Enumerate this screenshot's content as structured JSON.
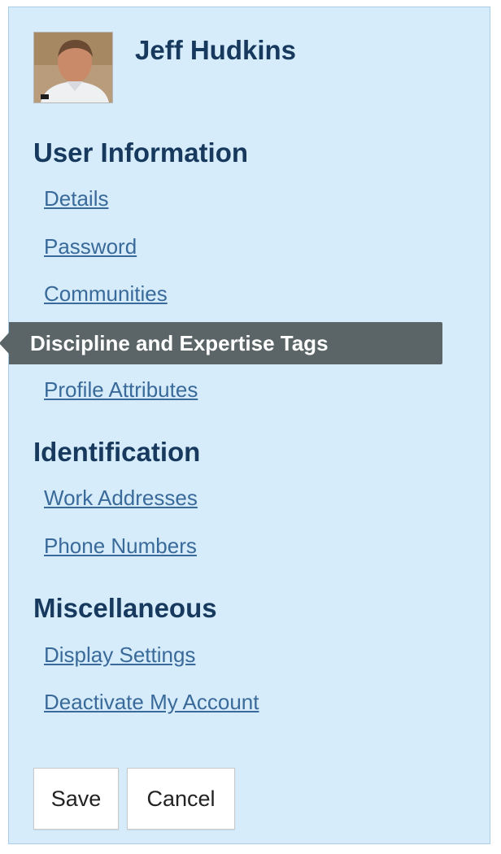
{
  "profile": {
    "name": "Jeff Hudkins",
    "avatar_icon": "user-photo"
  },
  "sections": {
    "user_information": {
      "title": "User Information",
      "links": {
        "details": "Details",
        "password": "Password",
        "communities": "Communities",
        "discipline_tags": "Discipline and Expertise Tags",
        "profile_attributes": "Profile Attributes"
      },
      "active_link": "Discipline and Expertise Tags"
    },
    "identification": {
      "title": "Identification",
      "links": {
        "work_addresses": "Work Addresses",
        "phone_numbers": "Phone Numbers"
      }
    },
    "miscellaneous": {
      "title": "Miscellaneous",
      "links": {
        "display_settings": "Display Settings",
        "deactivate_account": "Deactivate My Account"
      }
    }
  },
  "buttons": {
    "save": "Save",
    "cancel": "Cancel"
  },
  "colors": {
    "panel_background": "#d6ecfa",
    "heading": "#16395d",
    "link": "#3a6a9a",
    "active_item_background": "#5b6466"
  }
}
